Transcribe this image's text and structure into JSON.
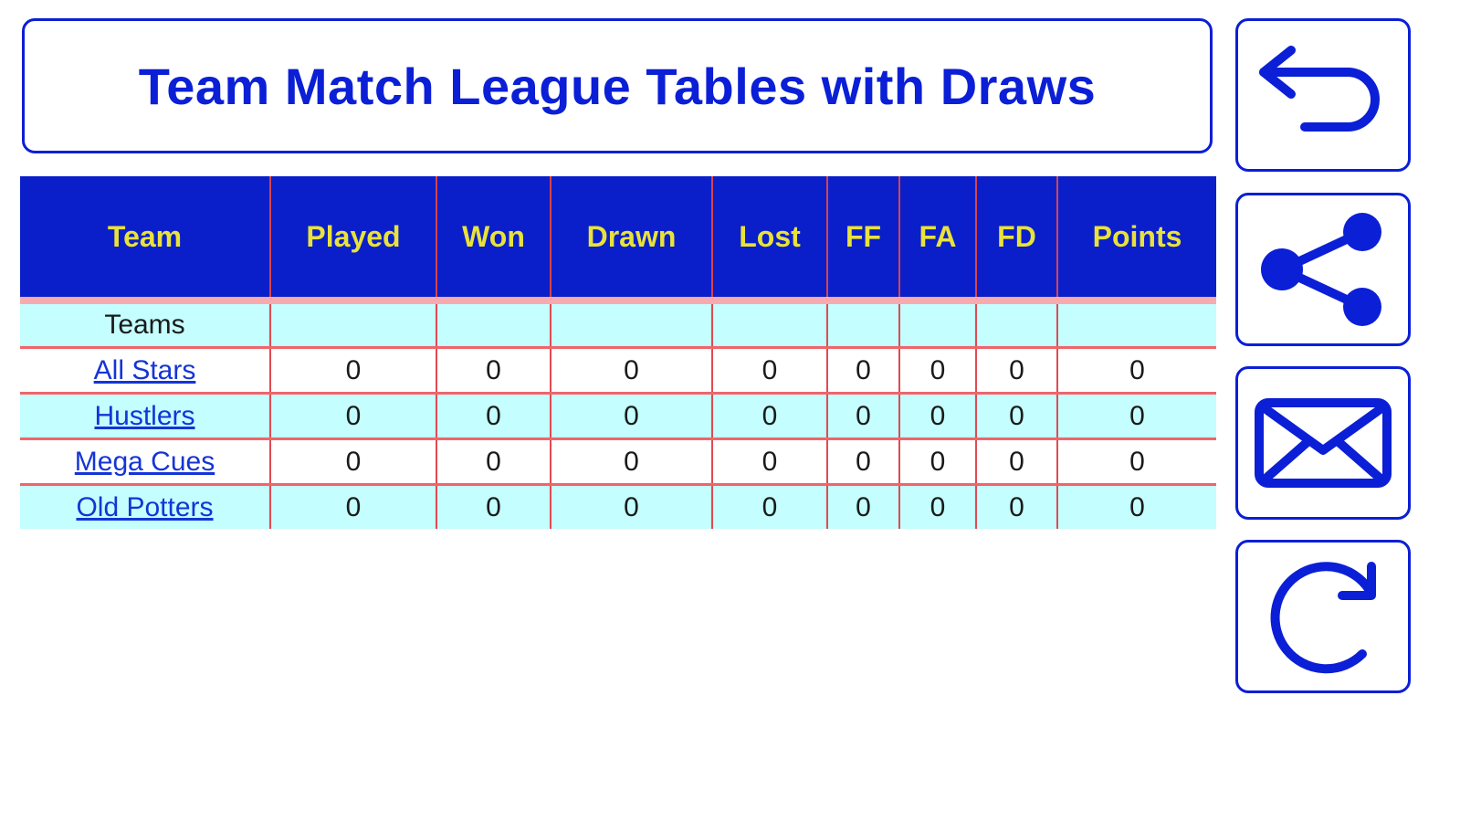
{
  "title": "Team Match League Tables with Draws",
  "table": {
    "columns": [
      "Team",
      "Played",
      "Won",
      "Drawn",
      "Lost",
      "FF",
      "FA",
      "FD",
      "Points"
    ],
    "section_label": "Teams",
    "rows": [
      {
        "team": "All Stars",
        "values": [
          "0",
          "0",
          "0",
          "0",
          "0",
          "0",
          "0",
          "0"
        ]
      },
      {
        "team": "Hustlers",
        "values": [
          "0",
          "0",
          "0",
          "0",
          "0",
          "0",
          "0",
          "0"
        ]
      },
      {
        "team": "Mega Cues",
        "values": [
          "0",
          "0",
          "0",
          "0",
          "0",
          "0",
          "0",
          "0"
        ]
      },
      {
        "team": "Old Potters",
        "values": [
          "0",
          "0",
          "0",
          "0",
          "0",
          "0",
          "0",
          "0"
        ]
      }
    ]
  },
  "sidebar": {
    "buttons": [
      {
        "icon": "back-arrow-icon"
      },
      {
        "icon": "share-icon"
      },
      {
        "icon": "mail-icon"
      },
      {
        "icon": "refresh-icon"
      }
    ]
  },
  "colors": {
    "accent": "#0b1fd6",
    "header_bg": "#0a1fc9",
    "header_text": "#e8e23a",
    "row_cyan": "#c4fefe",
    "grid_lines": "#e04a52"
  }
}
